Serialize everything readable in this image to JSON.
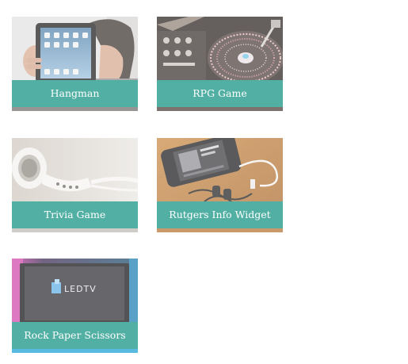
{
  "tiles": [
    {
      "title": "Hangman",
      "image": "person-holding-tablet-photo",
      "accent": "#0f9281"
    },
    {
      "title": "RPG Game",
      "image": "dj-turntable-with-lights-photo",
      "accent": "#0f9281"
    },
    {
      "title": "Trivia Game",
      "image": "white-earbuds-photo",
      "accent": "#0f9281"
    },
    {
      "title": "Rutgers Info Widget",
      "image": "smartphone-with-earphones-photo",
      "accent": "#0f9281"
    },
    {
      "title": "Rock Paper Scissors",
      "image": "led-tv-screen-photo",
      "accent": "#0f9281"
    }
  ]
}
